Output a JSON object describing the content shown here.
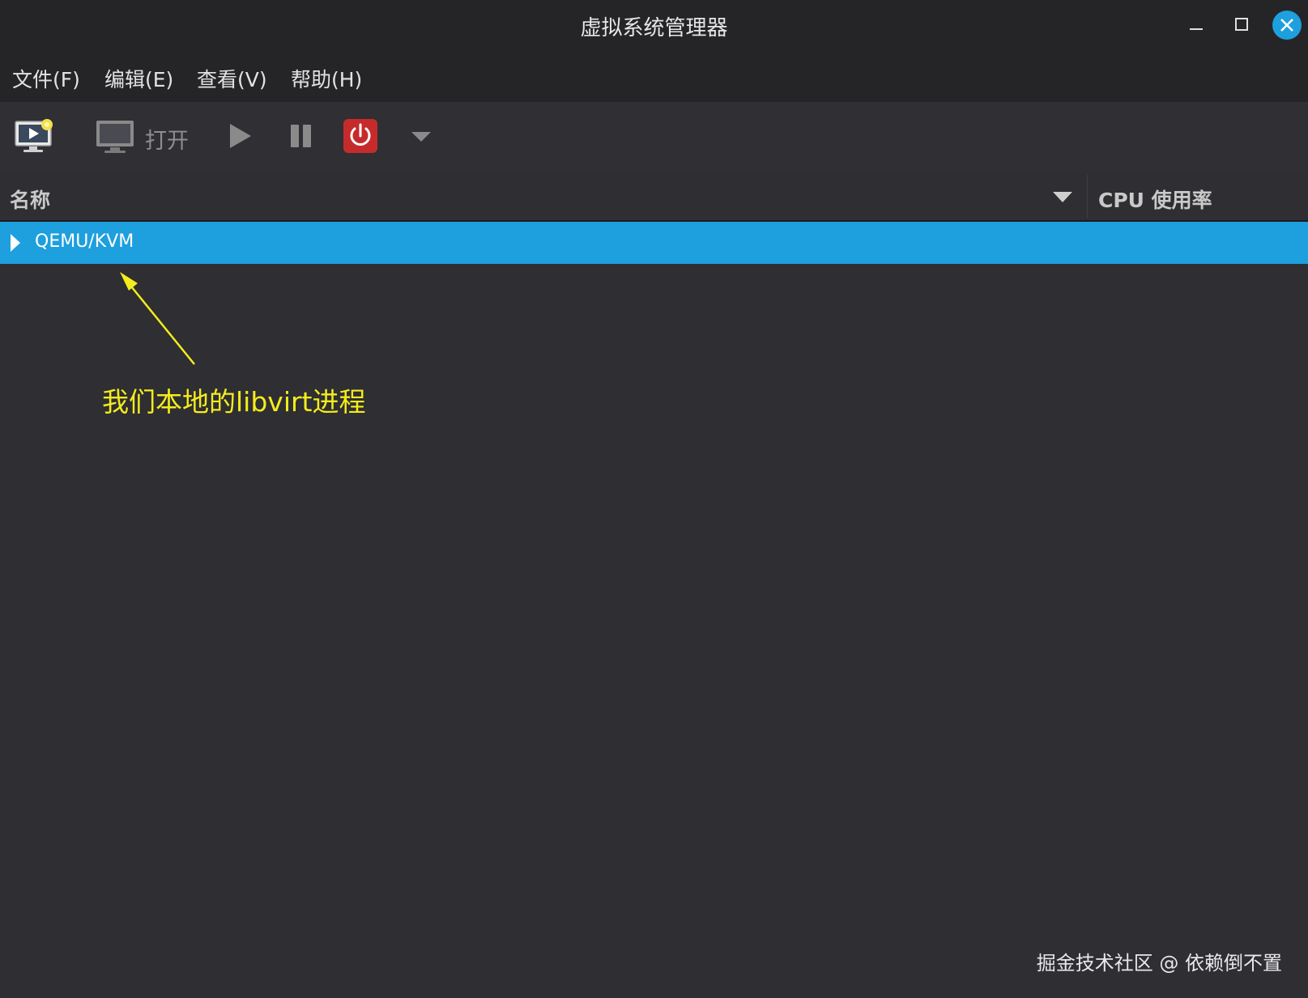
{
  "window": {
    "title": "虚拟系统管理器"
  },
  "menubar": {
    "items": [
      {
        "label": "文件(F)"
      },
      {
        "label": "编辑(E)"
      },
      {
        "label": "查看(V)"
      },
      {
        "label": "帮助(H)"
      }
    ]
  },
  "toolbar": {
    "new_vm_icon": "monitor-new-icon",
    "open_label": "打开",
    "open_icon": "monitor-icon",
    "run_icon": "play-icon",
    "pause_icon": "pause-icon",
    "shutdown_icon": "power-icon",
    "shutdown_menu_icon": "chevron-down-icon"
  },
  "list": {
    "columns": [
      {
        "label": "名称"
      },
      {
        "label": "CPU 使用率"
      }
    ],
    "rows": [
      {
        "label": "QEMU/KVM",
        "selected": true
      }
    ]
  },
  "annotation": {
    "text": "我们本地的libvirt进程",
    "color": "#f4ec1c"
  },
  "watermark": "掘金技术社区 @ 依赖倒不置",
  "colors": {
    "selection": "#1e9fde",
    "background": "#2e2e33",
    "titlebar": "#252528",
    "close_button": "#1e9fde",
    "power_button": "#c62b2b"
  }
}
